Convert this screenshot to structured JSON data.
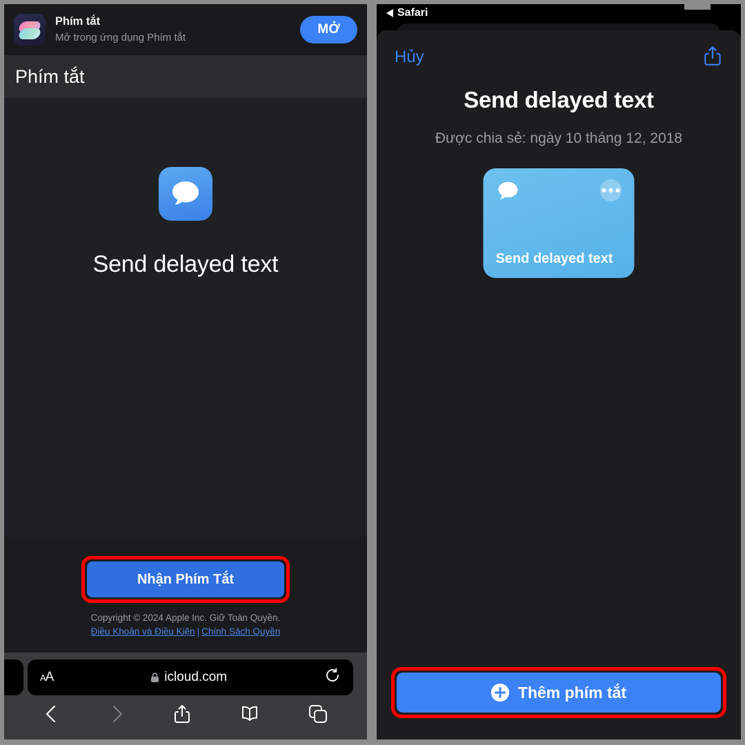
{
  "left_panel": {
    "app_banner": {
      "icon": "shortcuts-app-icon",
      "title": "Phím tắt",
      "subtitle": "Mở trong ứng dụng Phím tắt",
      "open_label": "MỞ"
    },
    "page_header": {
      "title": "Phím tắt"
    },
    "hero": {
      "icon": "message-bubble-icon",
      "title": "Send delayed text"
    },
    "get_button": {
      "label": "Nhận Phím Tắt",
      "highlight_color": "#ff0000",
      "fill_color": "#2f6fe0"
    },
    "footer": {
      "copyright": "Copyright © 2024 Apple Inc. Giữ Toàn Quyền.",
      "terms_link": "Điều Khoản và Điều Kiện",
      "separator": "|",
      "privacy_link": "Chính Sách Quyền"
    },
    "safari": {
      "font_size_label_small": "A",
      "font_size_label_large": "A",
      "lock": "lock-icon",
      "url": "icloud.com",
      "reload": "reload-icon",
      "back": "back-chevron-icon",
      "forward": "forward-chevron-icon",
      "share": "share-icon",
      "bookmarks": "book-icon",
      "tabs": "tabs-icon"
    }
  },
  "right_panel": {
    "status_bar": {
      "back_app": "Safari"
    },
    "sheet": {
      "cancel_label": "Hủy",
      "share_icon": "share-icon",
      "title": "Send delayed text",
      "shared_date": "Được chia sẻ: ngày 10 tháng 12, 2018"
    },
    "shortcut_card": {
      "glyph": "message-bubble-icon",
      "more": "ellipsis-icon",
      "label": "Send delayed text",
      "color": "#56b1e8"
    },
    "add_button": {
      "label": "Thêm phím tắt",
      "icon": "plus-circle-icon",
      "highlight_color": "#ff0000",
      "fill_color": "#3b82f6"
    }
  }
}
